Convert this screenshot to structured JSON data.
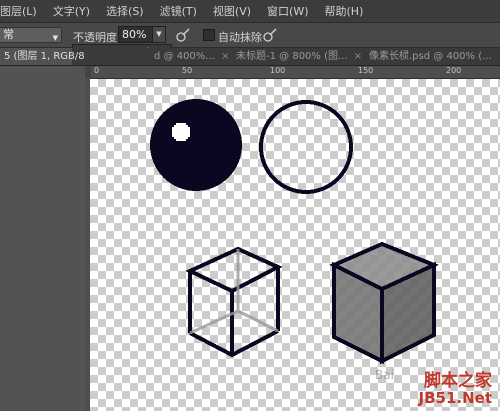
{
  "menubar": {
    "items": [
      "图层(L)",
      "文字(Y)",
      "选择(S)",
      "滤镜(T)",
      "视图(V)",
      "窗口(W)",
      "帮助(H)"
    ]
  },
  "options": {
    "mode_value": "常",
    "opacity_label": "不透明度:",
    "opacity_value": "80%",
    "auto_erase_label": "自动抹除",
    "opacity_slider_fraction": 0.8
  },
  "tabs": [
    {
      "label": "5 (图层 1, RGB/8",
      "active": true
    },
    {
      "label": "d @ 400%...",
      "active": false
    },
    {
      "label": "未标题-1 @ 800% (图...",
      "active": false
    },
    {
      "label": "像素长棂.psd @ 400% (...",
      "active": false
    }
  ],
  "ruler": {
    "top_ticks": [
      "0",
      "50",
      "100",
      "150",
      "200"
    ]
  },
  "watermark": {
    "faint_text": "Bai",
    "site_name": "脚本之家",
    "site_url": "JB51.Net"
  },
  "colors": {
    "menubar_bg": "#3c3c3c",
    "canvas_bg": "#535353",
    "pixel_ink": "#0a0820",
    "cube_fill": "#7a7a7a",
    "watermark_red": "#c0392b"
  }
}
